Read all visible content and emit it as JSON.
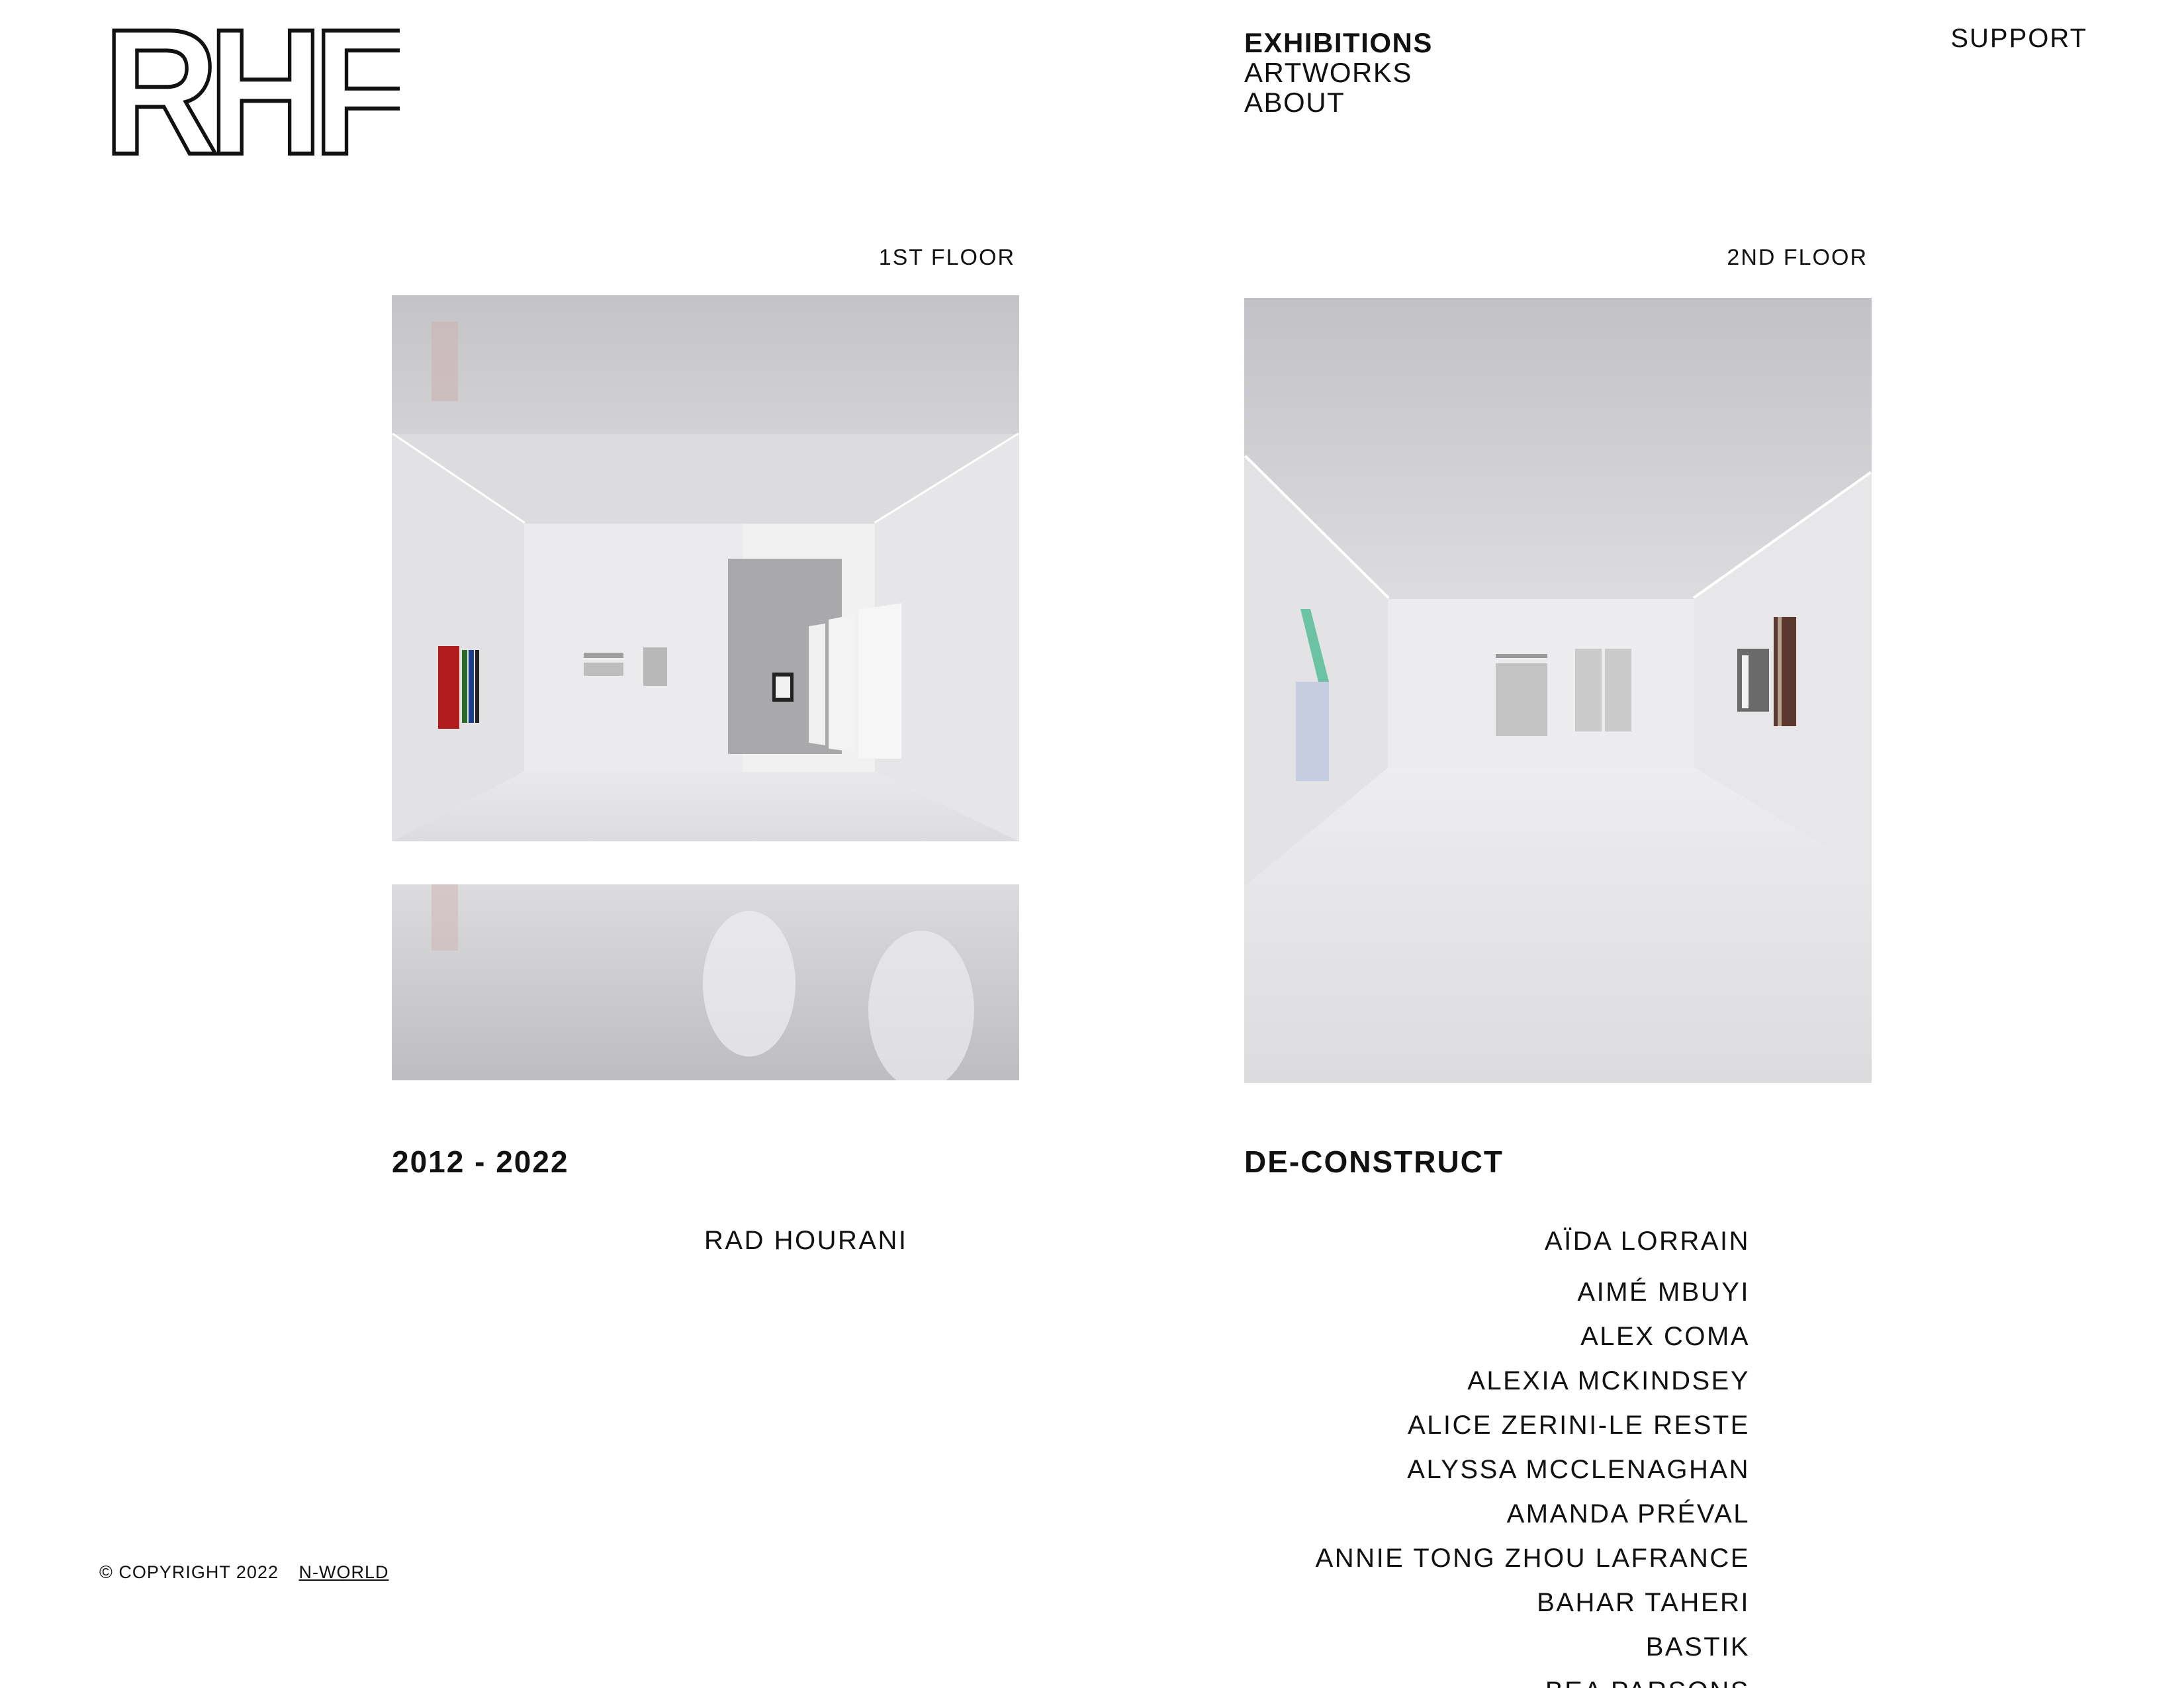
{
  "header": {
    "logo_text": "RHF",
    "nav": [
      {
        "label": "EXHIBITIONS",
        "active": true
      },
      {
        "label": "ARTWORKS",
        "active": false
      },
      {
        "label": "ABOUT",
        "active": false
      }
    ],
    "support_label": "SUPPORT"
  },
  "exhibitions": [
    {
      "floor": "1ST FLOOR",
      "title": "2012 - 2022",
      "artists": [
        "RAD HOURANI"
      ]
    },
    {
      "floor": "2ND FLOOR",
      "title": "DE-CONSTRUCT",
      "artists": [
        "AÏDA LORRAIN",
        "AIMÉ MBUYI",
        "ALEX COMA",
        "ALEXIA MCKINDSEY",
        "ALICE ZERINI-LE RESTE",
        "ALYSSA MCCLENAGHAN",
        "AMANDA PRÉVAL",
        "ANNIE TONG ZHOU LAFRANCE",
        "BAHAR TAHERI",
        "BASTIK",
        "BEA PARSONS"
      ]
    }
  ],
  "footer": {
    "copyright": "© COPYRIGHT 2022",
    "link_label": "N-WORLD"
  },
  "colors": {
    "text": "#111111",
    "background": "#ffffff",
    "gallery_wall": "#e6e6e8"
  }
}
